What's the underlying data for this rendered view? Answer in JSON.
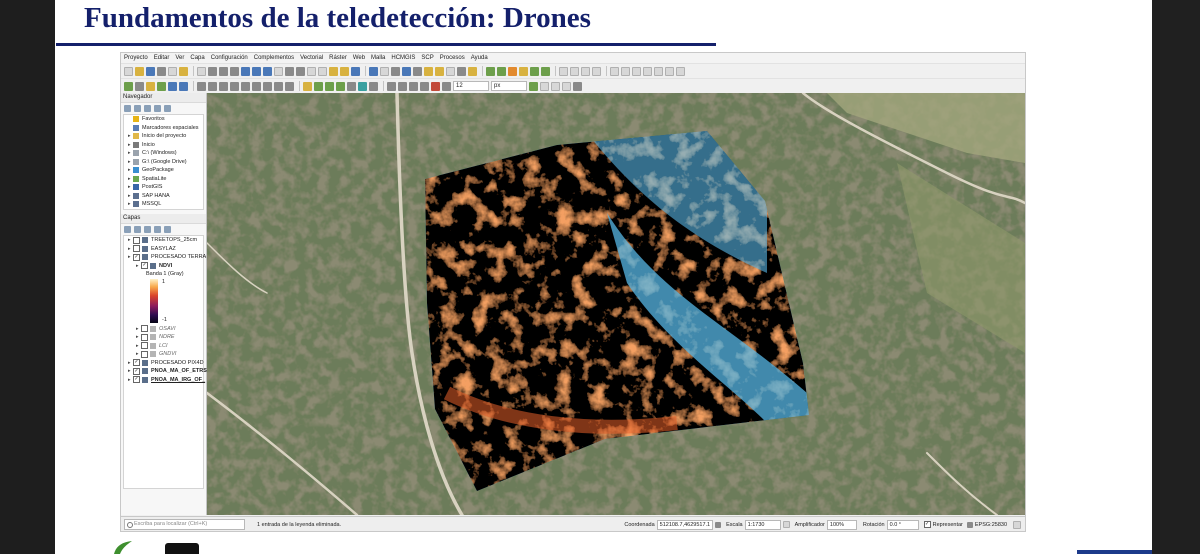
{
  "slide": {
    "title": "Fundamentos de la teledetección: Drones",
    "colors": {
      "title": "#14206b",
      "accent_bar": "#1c3a8a"
    }
  },
  "menubar": {
    "items": [
      "Proyecto",
      "Editar",
      "Ver",
      "Capa",
      "Configuración",
      "Complementos",
      "Vectorial",
      "Ráster",
      "Web",
      "Malla",
      "HCMGIS",
      "SCP",
      "Procesos",
      "Ayuda"
    ]
  },
  "toolbar2": {
    "font_size_value": "12",
    "unit_value": "px"
  },
  "browser_panel": {
    "title": "Navegador",
    "items": [
      {
        "label": "Favoritos",
        "icon": "star-icon"
      },
      {
        "label": "Marcadores espaciales",
        "icon": "bookmark-icon"
      },
      {
        "label": "Inicio del proyecto",
        "icon": "folder-icon"
      },
      {
        "label": "Inicio",
        "icon": "home-icon"
      },
      {
        "label": "C:\\ (Windows)",
        "icon": "drive-icon"
      },
      {
        "label": "G:\\ (Google Drive)",
        "icon": "drive-icon"
      },
      {
        "label": "GeoPackage",
        "icon": "geopackage-icon"
      },
      {
        "label": "SpatiaLite",
        "icon": "spatialite-icon"
      },
      {
        "label": "PostGIS",
        "icon": "postgis-icon"
      },
      {
        "label": "SAP HANA",
        "icon": "database-icon"
      },
      {
        "label": "MSSQL",
        "icon": "database-icon"
      }
    ]
  },
  "layers_panel": {
    "title": "Capas",
    "layers": [
      {
        "label": "TREETOPS_25cm",
        "checked": false,
        "style": "normal",
        "indent": 0
      },
      {
        "label": "EASYLAZ",
        "checked": false,
        "style": "normal",
        "indent": 0
      },
      {
        "label": "PROCESADO TERRA",
        "checked": true,
        "style": "normal",
        "indent": 0
      },
      {
        "label": "NDVI",
        "checked": true,
        "style": "bold",
        "indent": 1
      }
    ],
    "ndvi_band": "Banda 1 (Gray)",
    "ramp_max": "1",
    "ramp_min": "-1",
    "more_layers": [
      {
        "label": "OSAVI",
        "checked": false,
        "style": "italic",
        "indent": 1
      },
      {
        "label": "NDRE",
        "checked": false,
        "style": "italic",
        "indent": 1
      },
      {
        "label": "LCI",
        "checked": false,
        "style": "italic",
        "indent": 1
      },
      {
        "label": "GNDVI",
        "checked": false,
        "style": "italic",
        "indent": 1
      },
      {
        "label": "PROCESADO PIX4D",
        "checked": true,
        "style": "normal",
        "indent": 0
      },
      {
        "label": "PNOA_MA_OF_ETRS",
        "checked": true,
        "style": "bold",
        "indent": 0
      },
      {
        "label": "PNOA_MA_IRG_OF_",
        "checked": true,
        "style": "bold-underline",
        "indent": 0
      }
    ]
  },
  "statusbar": {
    "search_placeholder": "Escriba para localizar (Ctrl+K)",
    "message": "1 entrada de la leyenda eliminada.",
    "coord_label": "Coordenada",
    "coord_value": "512108.7,4629517.1",
    "scale_label": "Escala",
    "scale_value": "1:1730",
    "magnifier_label": "Amplificador",
    "magnifier_value": "100%",
    "rotation_label": "Rotación",
    "rotation_value": "0.0 °",
    "render_label": "Representar",
    "crs": "EPSG:25830"
  }
}
